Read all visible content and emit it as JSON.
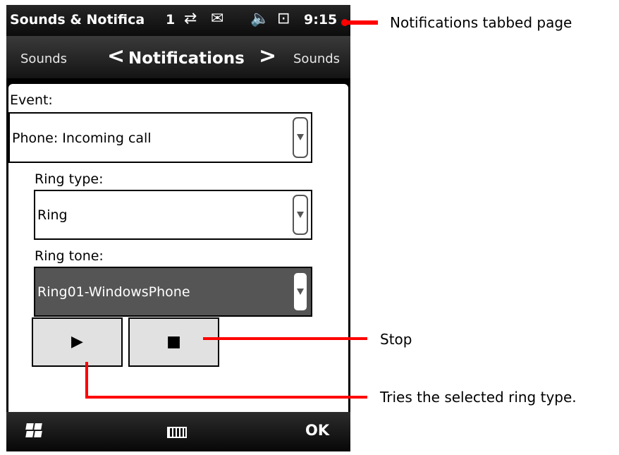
{
  "statusbar": {
    "title": "Sounds & Notifica",
    "signal": "1",
    "icons": [
      "sync-arrows-icon",
      "message-icon",
      "speaker-muted-icon",
      "battery-plug-icon"
    ],
    "time": "9:15"
  },
  "tabs": {
    "left": "Sounds",
    "current": "Notifications",
    "right": "Sounds",
    "prev_glyph": "<",
    "next_glyph": ">"
  },
  "form": {
    "event_label": "Event:",
    "event_value": "Phone: Incoming call",
    "ring_type_label": "Ring type:",
    "ring_type_value": "Ring",
    "ring_tone_label": "Ring tone:",
    "ring_tone_value": "Ring01-WindowsPhone"
  },
  "buttons": {
    "play_glyph": "▶",
    "stop_glyph": "■"
  },
  "softbar": {
    "ok_label": "OK"
  },
  "callouts": {
    "tabbed_page": "Notifications tabbed page",
    "stop": "Stop",
    "tries": "Tries the selected ring type."
  },
  "colors": {
    "callout": "#ff0000",
    "selected_combo": "#555555"
  }
}
